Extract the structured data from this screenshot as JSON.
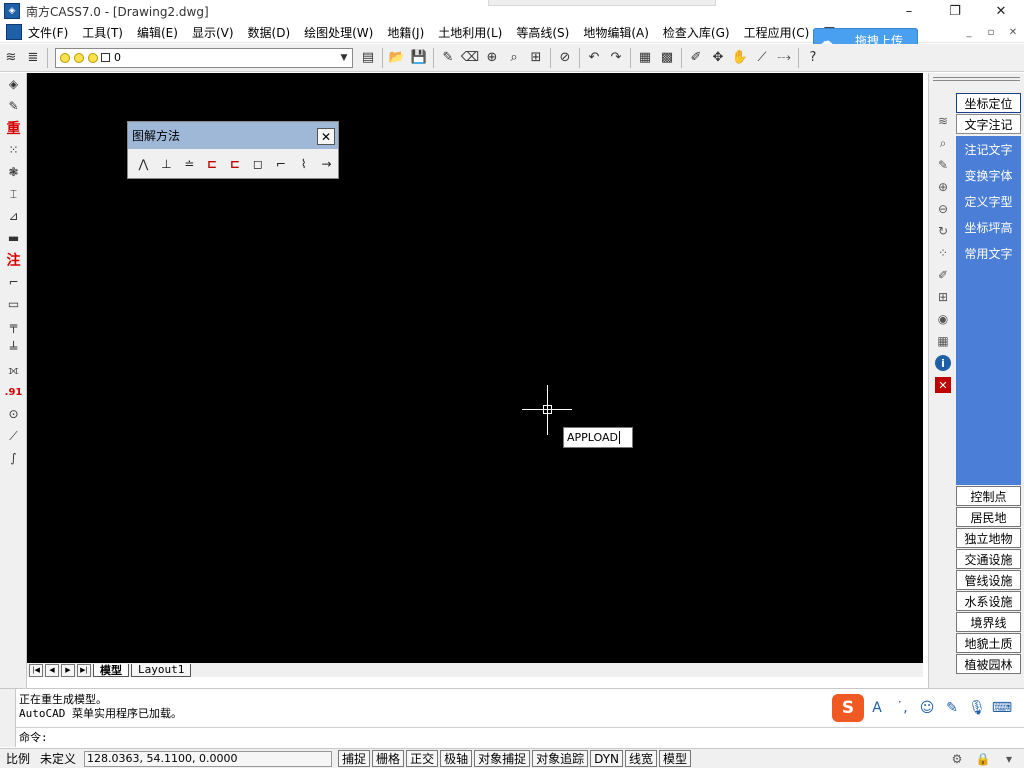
{
  "window": {
    "title": "南方CASS7.0 - [Drawing2.dwg]",
    "controls": [
      "–",
      "❐",
      "✕"
    ],
    "mdi_controls": [
      "_",
      "▫",
      "✕"
    ]
  },
  "menu": {
    "items": [
      "文件(F)",
      "工具(T)",
      "编辑(E)",
      "显示(V)",
      "数据(D)",
      "绘图处理(W)",
      "地籍(J)",
      "土地利用(L)",
      "等高线(S)",
      "地物编辑(A)",
      "检查入库(G)",
      "工程应用(C)",
      "图"
    ]
  },
  "upload": {
    "label": "拖拽上传"
  },
  "layer": {
    "value": "0"
  },
  "floating_toolbar": {
    "title": "图解方法"
  },
  "command_tip": {
    "text": "APPLOAD"
  },
  "tabs": {
    "model": "模型",
    "layout": "Layout1"
  },
  "right_panel": {
    "top_buttons": [
      "坐标定位",
      "文字注记"
    ],
    "sub_items": [
      "注记文字",
      "变换字体",
      "定义字型",
      "坐标坪高",
      "常用文字"
    ],
    "categories": [
      "控制点",
      "居民地",
      "独立地物",
      "交通设施",
      "管线设施",
      "水系设施",
      "境界线",
      "地貌土质",
      "植被园林"
    ]
  },
  "left_toolbar": {
    "zhong": "重",
    "zhu": "注",
    "num": ".91"
  },
  "command": {
    "lines": [
      "正在重生成模型。",
      "AutoCAD 菜单实用程序已加载。"
    ],
    "prompt": "命令:"
  },
  "status": {
    "scale_label": "比例",
    "scale_value": "未定义",
    "coords": "128.0363,  54.1100,  0.0000",
    "buttons": [
      "捕捉",
      "栅格",
      "正交",
      "极轴",
      "对象捕捉",
      "对象追踪",
      "DYN",
      "线宽",
      "模型"
    ]
  },
  "colors": {
    "canvas": "#000000",
    "panel_blue": "#4b7ed6",
    "upload_blue": "#4aa0f0",
    "ime_orange": "#f05a22",
    "float_title": "#9fb8d8"
  }
}
